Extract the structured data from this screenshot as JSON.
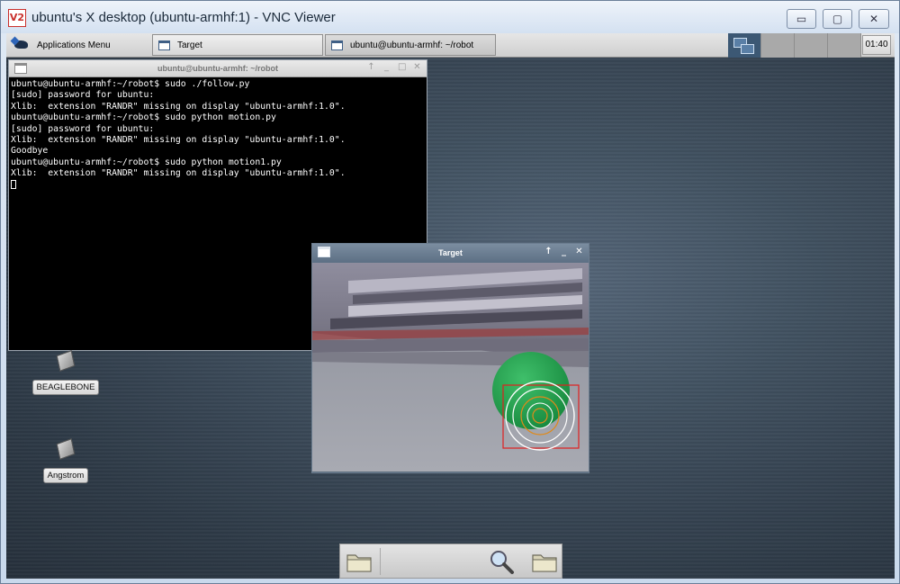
{
  "vnc": {
    "title": "ubuntu's X desktop (ubuntu-armhf:1) - VNC Viewer",
    "logo_text": "V2",
    "minimize": "▭",
    "maximize": "▢",
    "close": "✕"
  },
  "taskbar": {
    "app_menu_label": "Applications Menu",
    "tasks": [
      {
        "label": "Target"
      },
      {
        "label": "ubuntu@ubuntu-armhf: ~/robot"
      }
    ],
    "clock": "01:40"
  },
  "terminal": {
    "title": "ubuntu@ubuntu-armhf: ~/robot",
    "lines": [
      "ubuntu@ubuntu-armhf:~/robot$ sudo ./follow.py",
      "[sudo] password for ubuntu:",
      "Xlib:  extension \"RANDR\" missing on display \"ubuntu-armhf:1.0\".",
      "ubuntu@ubuntu-armhf:~/robot$ sudo python motion.py",
      "[sudo] password for ubuntu:",
      "Xlib:  extension \"RANDR\" missing on display \"ubuntu-armhf:1.0\".",
      "Goodbye",
      "ubuntu@ubuntu-armhf:~/robot$ sudo python motion1.py",
      "Xlib:  extension \"RANDR\" missing on display \"ubuntu-armhf:1.0\"."
    ],
    "controls": [
      "↑",
      "_",
      "□",
      "✕"
    ]
  },
  "desktop_icons": [
    {
      "label": "BEAGLEBONE"
    },
    {
      "label": "Angstrom"
    }
  ],
  "target_window": {
    "title": "Target",
    "controls": [
      "↑",
      "_",
      "✕"
    ]
  },
  "dock": {
    "items": [
      "folder-icon",
      "search-icon",
      "folder-icon"
    ]
  }
}
